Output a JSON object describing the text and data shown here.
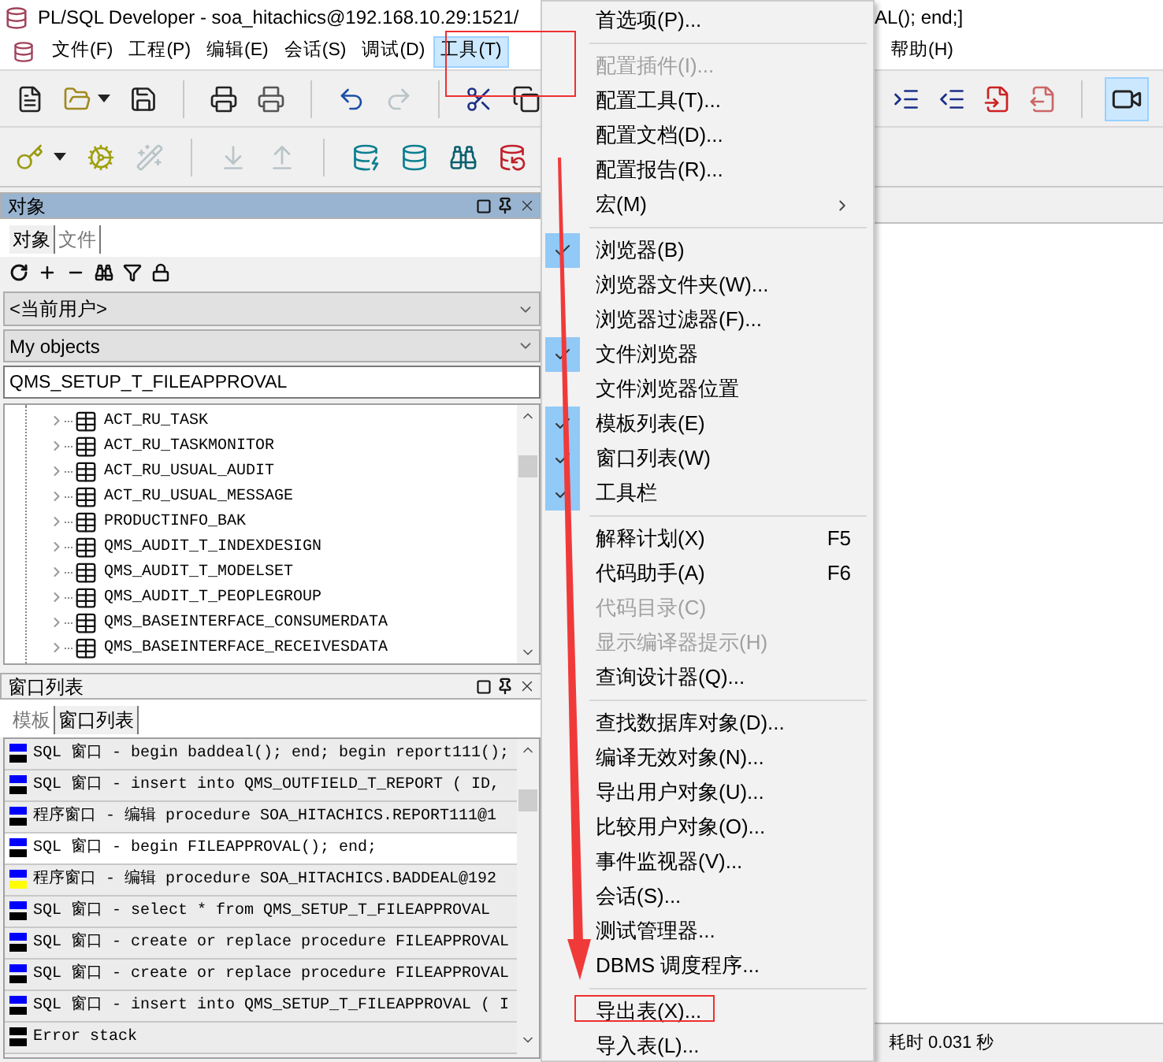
{
  "window": {
    "title_start": "PL/SQL Developer - soa_hitachics@192.168.10.29:1521/",
    "title_end": "AL(); end;]"
  },
  "menu_bar": [
    {
      "label": "文件(F)",
      "selected": false
    },
    {
      "label": "工程(P)",
      "selected": false
    },
    {
      "label": "编辑(E)",
      "selected": false
    },
    {
      "label": "会话(S)",
      "selected": false
    },
    {
      "label": "调试(D)",
      "selected": false
    },
    {
      "label": "工具(T)",
      "selected": true
    },
    {
      "label": "帮助(H)",
      "selected": false
    }
  ],
  "objects_panel": {
    "title": "对象",
    "tabs": [
      {
        "label": "对象",
        "selected": true
      },
      {
        "label": "文件",
        "selected": false
      }
    ],
    "user_select": "<当前用户>",
    "filter_select": "My objects",
    "search": "QMS_SETUP_T_FILEAPPROVAL",
    "tree_items": [
      "ACT_RU_TASK",
      "ACT_RU_TASKMONITOR",
      "ACT_RU_USUAL_AUDIT",
      "ACT_RU_USUAL_MESSAGE",
      "PRODUCTINFO_BAK",
      "QMS_AUDIT_T_INDEXDESIGN",
      "QMS_AUDIT_T_MODELSET",
      "QMS_AUDIT_T_PEOPLEGROUP",
      "QMS_BASEINTERFACE_CONSUMERDATA",
      "QMS_BASEINTERFACE_RECEIVESDATA"
    ]
  },
  "window_list_panel": {
    "title": "窗口列表",
    "tabs": [
      {
        "label": "模板",
        "selected": false
      },
      {
        "label": "窗口列表",
        "selected": true
      }
    ],
    "items": [
      {
        "text": "SQL 窗口 - begin baddeal(); end; begin report111();",
        "color": "#0000ff",
        "modified": false,
        "selected": false
      },
      {
        "text": "SQL 窗口 - insert into QMS_OUTFIELD_T_REPORT ( ID,",
        "color": "#0000ff",
        "modified": false,
        "selected": false
      },
      {
        "text": "程序窗口 - 编辑 procedure SOA_HITACHICS.REPORT111@1",
        "color": "#0000ff",
        "modified": false,
        "selected": false
      },
      {
        "text": "SQL 窗口 - begin FILEAPPROVAL(); end;",
        "color": "#0000ff",
        "modified": false,
        "selected": true
      },
      {
        "text": "程序窗口 - 编辑 procedure SOA_HITACHICS.BADDEAL@192",
        "color": "#0000ff",
        "modified": true,
        "selected": false
      },
      {
        "text": "SQL 窗口 - select * from QMS_SETUP_T_FILEAPPROVAL",
        "color": "#0000ff",
        "modified": false,
        "selected": false
      },
      {
        "text": "SQL 窗口 - create or replace procedure FILEAPPROVAL",
        "color": "#0000ff",
        "modified": false,
        "selected": false
      },
      {
        "text": "SQL 窗口 - create or replace procedure FILEAPPROVAL",
        "color": "#0000ff",
        "modified": false,
        "selected": false
      },
      {
        "text": "SQL 窗口 - insert into QMS_SETUP_T_FILEAPPROVAL ( I",
        "color": "#0000ff",
        "modified": false,
        "selected": false
      },
      {
        "text": "Error stack",
        "color": "#000000",
        "modified": false,
        "selected": false
      }
    ]
  },
  "tools_menu": [
    {
      "kind": "item",
      "label": "首选项(P)...",
      "checked": false,
      "disabled": false,
      "submenu": false
    },
    {
      "kind": "separator"
    },
    {
      "kind": "item",
      "label": "配置插件(I)...",
      "checked": false,
      "disabled": true,
      "submenu": false
    },
    {
      "kind": "item",
      "label": "配置工具(T)...",
      "checked": false,
      "disabled": false,
      "submenu": false
    },
    {
      "kind": "item",
      "label": "配置文档(D)...",
      "checked": false,
      "disabled": false,
      "submenu": false
    },
    {
      "kind": "item",
      "label": "配置报告(R)...",
      "checked": false,
      "disabled": false,
      "submenu": false
    },
    {
      "kind": "item",
      "label": "宏(M)",
      "checked": false,
      "disabled": false,
      "submenu": true
    },
    {
      "kind": "separator"
    },
    {
      "kind": "item",
      "label": "浏览器(B)",
      "checked": true,
      "disabled": false,
      "submenu": false
    },
    {
      "kind": "item",
      "label": "浏览器文件夹(W)...",
      "checked": false,
      "disabled": false,
      "submenu": false
    },
    {
      "kind": "item",
      "label": "浏览器过滤器(F)...",
      "checked": false,
      "disabled": false,
      "submenu": false
    },
    {
      "kind": "item",
      "label": "文件浏览器",
      "checked": true,
      "disabled": false,
      "submenu": false
    },
    {
      "kind": "item",
      "label": "文件浏览器位置",
      "checked": false,
      "disabled": false,
      "submenu": false
    },
    {
      "kind": "item",
      "label": "模板列表(E)",
      "checked": true,
      "disabled": false,
      "submenu": false
    },
    {
      "kind": "item",
      "label": "窗口列表(W)",
      "checked": true,
      "disabled": false,
      "submenu": false
    },
    {
      "kind": "item",
      "label": "工具栏",
      "checked": true,
      "disabled": false,
      "submenu": false
    },
    {
      "kind": "separator"
    },
    {
      "kind": "item",
      "label": "解释计划(X)",
      "shortcut": "F5",
      "checked": false,
      "disabled": false,
      "submenu": false
    },
    {
      "kind": "item",
      "label": "代码助手(A)",
      "shortcut": "F6",
      "checked": false,
      "disabled": false,
      "submenu": false
    },
    {
      "kind": "item",
      "label": "代码目录(C)",
      "checked": false,
      "disabled": true,
      "submenu": false
    },
    {
      "kind": "item",
      "label": "显示编译器提示(H)",
      "checked": false,
      "disabled": true,
      "submenu": false
    },
    {
      "kind": "item",
      "label": "查询设计器(Q)...",
      "checked": false,
      "disabled": false,
      "submenu": false
    },
    {
      "kind": "separator"
    },
    {
      "kind": "item",
      "label": "查找数据库对象(D)...",
      "checked": false,
      "disabled": false,
      "submenu": false
    },
    {
      "kind": "item",
      "label": "编译无效对象(N)...",
      "checked": false,
      "disabled": false,
      "submenu": false
    },
    {
      "kind": "item",
      "label": "导出用户对象(U)...",
      "checked": false,
      "disabled": false,
      "submenu": false
    },
    {
      "kind": "item",
      "label": "比较用户对象(O)...",
      "checked": false,
      "disabled": false,
      "submenu": false
    },
    {
      "kind": "item",
      "label": "事件监视器(V)...",
      "checked": false,
      "disabled": false,
      "submenu": false
    },
    {
      "kind": "item",
      "label": "会话(S)...",
      "checked": false,
      "disabled": false,
      "submenu": false
    },
    {
      "kind": "item",
      "label": "测试管理器...",
      "checked": false,
      "disabled": false,
      "submenu": false
    },
    {
      "kind": "item",
      "label": "DBMS 调度程序...",
      "checked": false,
      "disabled": false,
      "submenu": false
    },
    {
      "kind": "separator"
    },
    {
      "kind": "item",
      "label": "导出表(X)...",
      "checked": false,
      "disabled": false,
      "submenu": false
    },
    {
      "kind": "item",
      "label": "导入表(L)...",
      "checked": false,
      "disabled": false,
      "submenu": false
    }
  ],
  "status_bar": {
    "elapsed": "耗时 0.031 秒"
  }
}
